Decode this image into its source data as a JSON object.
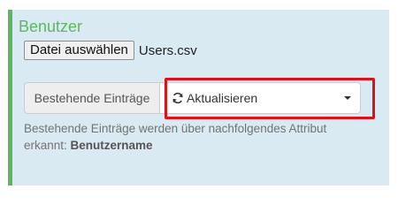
{
  "panel": {
    "title": "Benutzer",
    "accent_color": "#5cb85c",
    "background_color": "#daeaf3"
  },
  "file_input": {
    "button_label": "Datei auswählen",
    "file_name": "Users.csv"
  },
  "existing_entries": {
    "addon_label": "Bestehende Einträge",
    "select_value": "Aktualisieren",
    "icon": "refresh-icon",
    "highlight_color": "#e0101a"
  },
  "help": {
    "text": "Bestehende Einträge werden über nachfolgendes Attribut erkannt: ",
    "attribute": "Benutzername"
  }
}
